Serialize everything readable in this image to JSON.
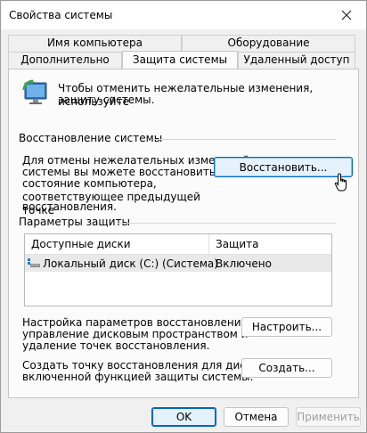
{
  "window": {
    "title": "Свойства системы",
    "close_icon": "close-icon"
  },
  "tabs": {
    "row_top": [
      {
        "label": "Имя компьютера"
      },
      {
        "label": "Оборудование"
      }
    ],
    "row_bottom": [
      {
        "label": "Дополнительно"
      },
      {
        "label": "Защита системы",
        "selected": true
      },
      {
        "label": "Удаленный доступ"
      }
    ]
  },
  "intro": {
    "icon": "system-protection-icon",
    "text_line1": "Чтобы отменить нежелательные изменения, используйте",
    "text_line2": "защиту системы."
  },
  "restore": {
    "group_label": "Восстановление системы",
    "desc_line1": "Для отмены нежелательных изменений",
    "desc_line2": "системы вы можете восстановить",
    "desc_line3": "состояние компьютера, соответствующее предыдущей точке",
    "desc_line4": "восстановления.",
    "button_label": "Восстановить..."
  },
  "protection": {
    "group_label": "Параметры защиты",
    "columns": [
      "Доступные диски",
      "Защита"
    ],
    "rows": [
      {
        "drive": "Локальный диск (C:) (Система)",
        "status": "Включено",
        "icon": "drive-icon"
      }
    ],
    "configure_text_line1": "Настройка параметров восстановления,",
    "configure_text_line2": "управление дисковым пространством и",
    "configure_text_line3": "удаление точек восстановления.",
    "configure_button": "Настроить...",
    "create_text_line1": "Создать точку восстановления для дисков с",
    "create_text_line2": "включенной функцией защиты системы.",
    "create_button": "Создать..."
  },
  "footer": {
    "ok": "OK",
    "cancel": "Отмена",
    "apply": "Применить"
  },
  "colors": {
    "accent": "#0067c0",
    "panel": "#fbfbfb",
    "window": "#f0f0f0"
  }
}
